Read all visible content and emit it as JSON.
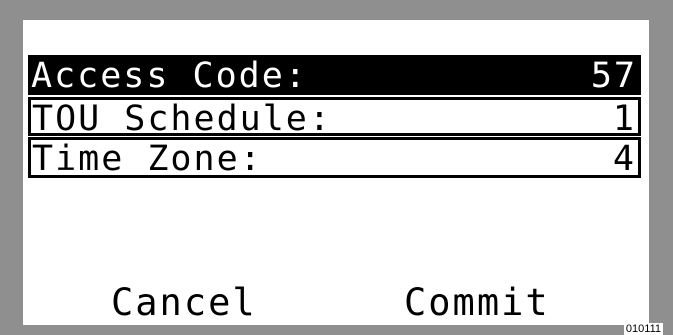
{
  "menu": {
    "items": [
      {
        "label": "Access Code:",
        "value": "57",
        "selected": true
      },
      {
        "label": "TOU Schedule:",
        "value": "1",
        "selected": false
      },
      {
        "label": "Time Zone:",
        "value": "4",
        "selected": false
      }
    ]
  },
  "softkeys": {
    "left_label": "Cancel",
    "right_label": "Commit"
  },
  "figure_id": "010111",
  "colors": {
    "bezel": "#8f8f8f",
    "screen_background": "#ffffff",
    "selection_background": "#000000",
    "selection_text": "#ffffff",
    "text": "#000000"
  }
}
